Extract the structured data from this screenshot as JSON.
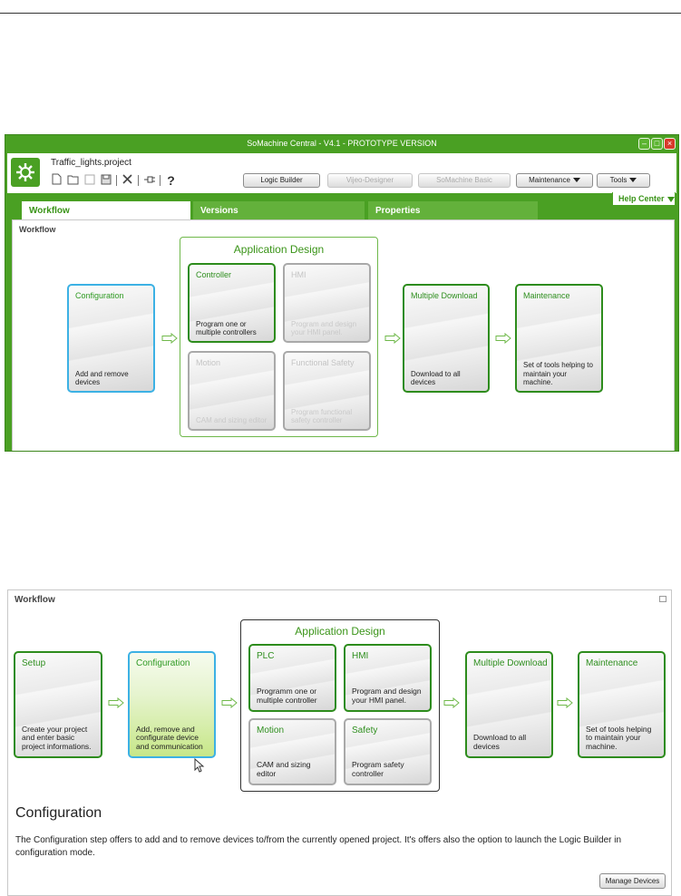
{
  "colors": {
    "brand_green": "#4aa023",
    "card_border_green": "#2d8c1c",
    "selected_border_blue": "#3cb1e4",
    "disabled_grey": "#a9a9a9"
  },
  "window": {
    "title": "SoMachine Central - V4.1 - PROTOTYPE VERSION",
    "project_name": "Traffic_lights.project",
    "toolbar_icons": [
      "new-file-icon",
      "open-folder-icon",
      "save-icon",
      "save-all-icon",
      "tools-icon",
      "plug-icon",
      "help-icon"
    ],
    "help_glyph": "?",
    "buttons": {
      "logic_builder": "Logic Builder",
      "vijeo_designer": "Vijeo-Designer",
      "somachine_basic": "SoMachine Basic",
      "maintenance": "Maintenance",
      "tools": "Tools"
    },
    "help_center": "Help Center",
    "tabs": {
      "workflow": "Workflow",
      "versions": "Versions",
      "properties": "Properties"
    },
    "panel_title": "Workflow",
    "group_title": "Application Design",
    "cards": {
      "configuration": {
        "title": "Configuration",
        "desc": "Add and remove devices"
      },
      "controller": {
        "title": "Controller",
        "desc": "Program one or multiple controllers"
      },
      "hmi": {
        "title": "HMI",
        "desc": "Program and design your HMI panel."
      },
      "motion": {
        "title": "Motion",
        "desc": "CAM and sizing editor"
      },
      "functional_safety": {
        "title": "Functional Safety",
        "desc": "Program functional safety controller"
      },
      "multiple_download": {
        "title": "Multiple Download",
        "desc": "Download to all devices"
      },
      "maintenance": {
        "title": "Maintenance",
        "desc": "Set of tools helping to maintain your machine."
      }
    }
  },
  "workflow2": {
    "panel_title": "Workflow",
    "group_title": "Application Design",
    "cards": {
      "setup": {
        "title": "Setup",
        "desc": "Create your project and enter basic project informations."
      },
      "configuration": {
        "title": "Configuration",
        "desc": "Add, remove and configurate device and communication"
      },
      "plc": {
        "title": "PLC",
        "desc": "Programm one or multiple controller"
      },
      "hmi": {
        "title": "HMI",
        "desc": "Program and design your HMI panel."
      },
      "motion": {
        "title": "Motion",
        "desc": "CAM and sizing editor"
      },
      "safety": {
        "title": "Safety",
        "desc": "Program safety controller"
      },
      "multiple_download": {
        "title": "Multiple Download",
        "desc": "Download to all devices"
      },
      "maintenance": {
        "title": "Maintenance",
        "desc": "Set of tools helping to maintain your machine."
      }
    },
    "section_heading": "Configuration",
    "section_text": "The Configuration step offers to add and to remove devices to/from the currently opened project. It's offers also the option to launch the Logic Builder in configuration mode.",
    "manage_button": "Manage Devices"
  }
}
